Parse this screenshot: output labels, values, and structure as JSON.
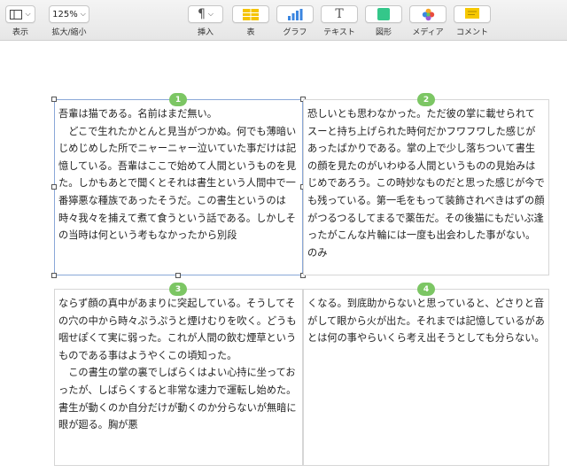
{
  "toolbar": {
    "view": {
      "label": "表示"
    },
    "zoom": {
      "value": "125%",
      "label": "拡大/縮小"
    },
    "insert": {
      "label": "挿入",
      "glyph": "¶"
    },
    "table": {
      "label": "表"
    },
    "chart": {
      "label": "グラフ"
    },
    "text": {
      "label": "テキスト",
      "glyph": "T"
    },
    "shape": {
      "label": "図形"
    },
    "media": {
      "label": "メディア"
    },
    "comment": {
      "label": "コメント"
    }
  },
  "colors": {
    "accent_green": "#7cc664",
    "table_icon": "#f5c400",
    "chart_icon": "#3b86e0",
    "shape_icon": "#34c78a",
    "comment_icon": "#f6c800",
    "selection": "#8aa8d8"
  },
  "frames": [
    {
      "number": "1",
      "text": "吾輩は猫である。名前はまだ無い。\n　どこで生れたかとんと見当がつかぬ。何でも薄暗いじめじめした所でニャーニャー泣いていた事だけは記憶している。吾輩はここで始めて人間というものを見た。しかもあとで聞くとそれは書生という人間中で一番獰悪な種族であったそうだ。この書生というのは時々我々を捕えて煮て食うという話である。しかしその当時は何という考もなかったから別段"
    },
    {
      "number": "2",
      "text": "恐しいとも思わなかった。ただ彼の掌に載せられてスーと持ち上げられた時何だかフワフワした感じがあったばかりである。掌の上で少し落ちついて書生の顔を見たのがいわゆる人間というものの見始みはじめであろう。この時妙なものだと思った感じが今でも残っている。第一毛をもって装飾されべきはずの顔がつるつるしてまるで薬缶だ。その後猫にもだいぶ逢ったがこんな片輪には一度も出会わした事がない。のみ"
    },
    {
      "number": "3",
      "text": "ならず顔の真中があまりに突起している。そうしてその穴の中から時々ぷうぷうと煙けむりを吹く。どうも咽せぽくて実に弱った。これが人間の飲む煙草というものである事はようやくこの頃知った。\n　この書生の掌の裏でしばらくはよい心持に坐っておったが、しばらくすると非常な速力で運転し始めた。書生が動くのか自分だけが動くのか分らないが無暗に眼が廻る。胸が悪"
    },
    {
      "number": "4",
      "text": "くなる。到底助からないと思っていると、どさりと音がして眼から火が出た。それまでは記憶しているがあとは何の事やらいくら考え出そうとしても分らない。"
    }
  ]
}
